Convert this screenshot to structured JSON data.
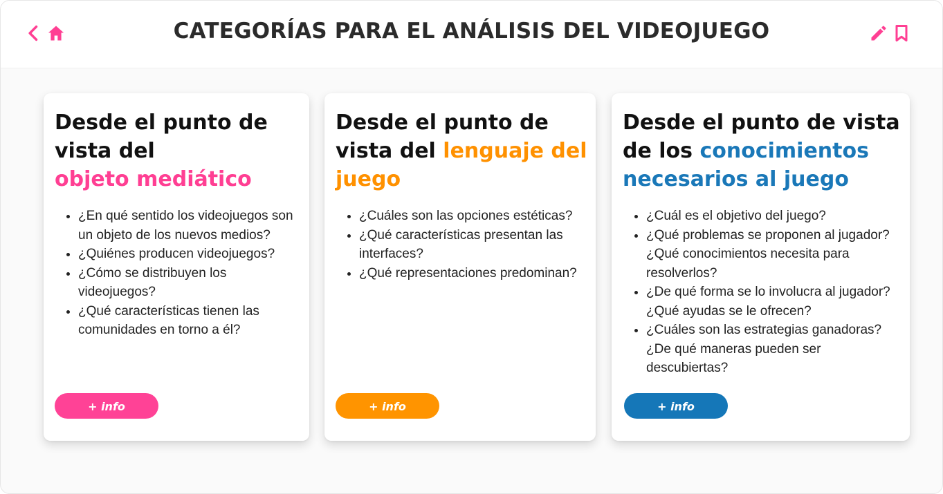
{
  "header": {
    "title": "CATEGORÍAS PARA EL ANÁLISIS DEL VIDEOJUEGO",
    "icons": [
      "back-icon",
      "home-icon",
      "edit-icon",
      "bookmark-icon"
    ]
  },
  "colors": {
    "pink": "#ff3f93",
    "orange": "#ff9100",
    "blue": "#1a78b8"
  },
  "cards": [
    {
      "heading_plain": "Desde el punto de vista del",
      "heading_highlight": "objeto mediático",
      "items": [
        "¿En  qué  sentido  los videojuegos son un  objeto  de los  nuevos medios?",
        "¿Quiénes producen videojuegos?",
        " ¿Cómo se distribuyen los videojuegos?",
        " ¿Qué características tienen las comunidades en torno a él?"
      ],
      "button_label": "+ info"
    },
    {
      "heading_plain": "Desde el punto de vista del",
      "heading_highlight": "lenguaje del juego",
      "items": [
        "¿Cuáles son las opciones estéticas?",
        "¿Qué características presentan las interfaces?",
        "¿Qué representaciones predominan?"
      ],
      "button_label": "+ info"
    },
    {
      "heading_plain": "Desde el punto de vista de los",
      "heading_highlight": "conocimientos necesarios al juego",
      "items": [
        "¿Cuál es el objetivo del juego?",
        "¿Qué problemas se proponen al jugador?¿Qué conocimientos necesita para resolverlos?",
        "¿De qué forma se lo involucra al jugador?¿Qué ayudas se le ofrecen?",
        "¿Cuáles son las estrategias ganadoras?¿De qué maneras pueden ser descubiertas?"
      ],
      "button_label": "+ info"
    }
  ]
}
